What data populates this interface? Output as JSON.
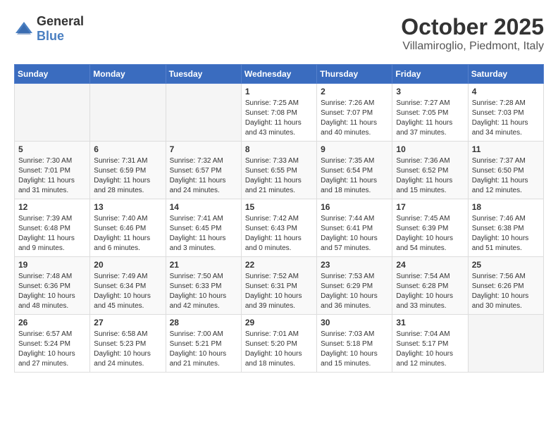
{
  "header": {
    "logo_general": "General",
    "logo_blue": "Blue",
    "month": "October 2025",
    "location": "Villamiroglio, Piedmont, Italy"
  },
  "weekdays": [
    "Sunday",
    "Monday",
    "Tuesday",
    "Wednesday",
    "Thursday",
    "Friday",
    "Saturday"
  ],
  "weeks": [
    [
      {
        "day": "",
        "info": ""
      },
      {
        "day": "",
        "info": ""
      },
      {
        "day": "",
        "info": ""
      },
      {
        "day": "1",
        "info": "Sunrise: 7:25 AM\nSunset: 7:08 PM\nDaylight: 11 hours\nand 43 minutes."
      },
      {
        "day": "2",
        "info": "Sunrise: 7:26 AM\nSunset: 7:07 PM\nDaylight: 11 hours\nand 40 minutes."
      },
      {
        "day": "3",
        "info": "Sunrise: 7:27 AM\nSunset: 7:05 PM\nDaylight: 11 hours\nand 37 minutes."
      },
      {
        "day": "4",
        "info": "Sunrise: 7:28 AM\nSunset: 7:03 PM\nDaylight: 11 hours\nand 34 minutes."
      }
    ],
    [
      {
        "day": "5",
        "info": "Sunrise: 7:30 AM\nSunset: 7:01 PM\nDaylight: 11 hours\nand 31 minutes."
      },
      {
        "day": "6",
        "info": "Sunrise: 7:31 AM\nSunset: 6:59 PM\nDaylight: 11 hours\nand 28 minutes."
      },
      {
        "day": "7",
        "info": "Sunrise: 7:32 AM\nSunset: 6:57 PM\nDaylight: 11 hours\nand 24 minutes."
      },
      {
        "day": "8",
        "info": "Sunrise: 7:33 AM\nSunset: 6:55 PM\nDaylight: 11 hours\nand 21 minutes."
      },
      {
        "day": "9",
        "info": "Sunrise: 7:35 AM\nSunset: 6:54 PM\nDaylight: 11 hours\nand 18 minutes."
      },
      {
        "day": "10",
        "info": "Sunrise: 7:36 AM\nSunset: 6:52 PM\nDaylight: 11 hours\nand 15 minutes."
      },
      {
        "day": "11",
        "info": "Sunrise: 7:37 AM\nSunset: 6:50 PM\nDaylight: 11 hours\nand 12 minutes."
      }
    ],
    [
      {
        "day": "12",
        "info": "Sunrise: 7:39 AM\nSunset: 6:48 PM\nDaylight: 11 hours\nand 9 minutes."
      },
      {
        "day": "13",
        "info": "Sunrise: 7:40 AM\nSunset: 6:46 PM\nDaylight: 11 hours\nand 6 minutes."
      },
      {
        "day": "14",
        "info": "Sunrise: 7:41 AM\nSunset: 6:45 PM\nDaylight: 11 hours\nand 3 minutes."
      },
      {
        "day": "15",
        "info": "Sunrise: 7:42 AM\nSunset: 6:43 PM\nDaylight: 11 hours\nand 0 minutes."
      },
      {
        "day": "16",
        "info": "Sunrise: 7:44 AM\nSunset: 6:41 PM\nDaylight: 10 hours\nand 57 minutes."
      },
      {
        "day": "17",
        "info": "Sunrise: 7:45 AM\nSunset: 6:39 PM\nDaylight: 10 hours\nand 54 minutes."
      },
      {
        "day": "18",
        "info": "Sunrise: 7:46 AM\nSunset: 6:38 PM\nDaylight: 10 hours\nand 51 minutes."
      }
    ],
    [
      {
        "day": "19",
        "info": "Sunrise: 7:48 AM\nSunset: 6:36 PM\nDaylight: 10 hours\nand 48 minutes."
      },
      {
        "day": "20",
        "info": "Sunrise: 7:49 AM\nSunset: 6:34 PM\nDaylight: 10 hours\nand 45 minutes."
      },
      {
        "day": "21",
        "info": "Sunrise: 7:50 AM\nSunset: 6:33 PM\nDaylight: 10 hours\nand 42 minutes."
      },
      {
        "day": "22",
        "info": "Sunrise: 7:52 AM\nSunset: 6:31 PM\nDaylight: 10 hours\nand 39 minutes."
      },
      {
        "day": "23",
        "info": "Sunrise: 7:53 AM\nSunset: 6:29 PM\nDaylight: 10 hours\nand 36 minutes."
      },
      {
        "day": "24",
        "info": "Sunrise: 7:54 AM\nSunset: 6:28 PM\nDaylight: 10 hours\nand 33 minutes."
      },
      {
        "day": "25",
        "info": "Sunrise: 7:56 AM\nSunset: 6:26 PM\nDaylight: 10 hours\nand 30 minutes."
      }
    ],
    [
      {
        "day": "26",
        "info": "Sunrise: 6:57 AM\nSunset: 5:24 PM\nDaylight: 10 hours\nand 27 minutes."
      },
      {
        "day": "27",
        "info": "Sunrise: 6:58 AM\nSunset: 5:23 PM\nDaylight: 10 hours\nand 24 minutes."
      },
      {
        "day": "28",
        "info": "Sunrise: 7:00 AM\nSunset: 5:21 PM\nDaylight: 10 hours\nand 21 minutes."
      },
      {
        "day": "29",
        "info": "Sunrise: 7:01 AM\nSunset: 5:20 PM\nDaylight: 10 hours\nand 18 minutes."
      },
      {
        "day": "30",
        "info": "Sunrise: 7:03 AM\nSunset: 5:18 PM\nDaylight: 10 hours\nand 15 minutes."
      },
      {
        "day": "31",
        "info": "Sunrise: 7:04 AM\nSunset: 5:17 PM\nDaylight: 10 hours\nand 12 minutes."
      },
      {
        "day": "",
        "info": ""
      }
    ]
  ]
}
